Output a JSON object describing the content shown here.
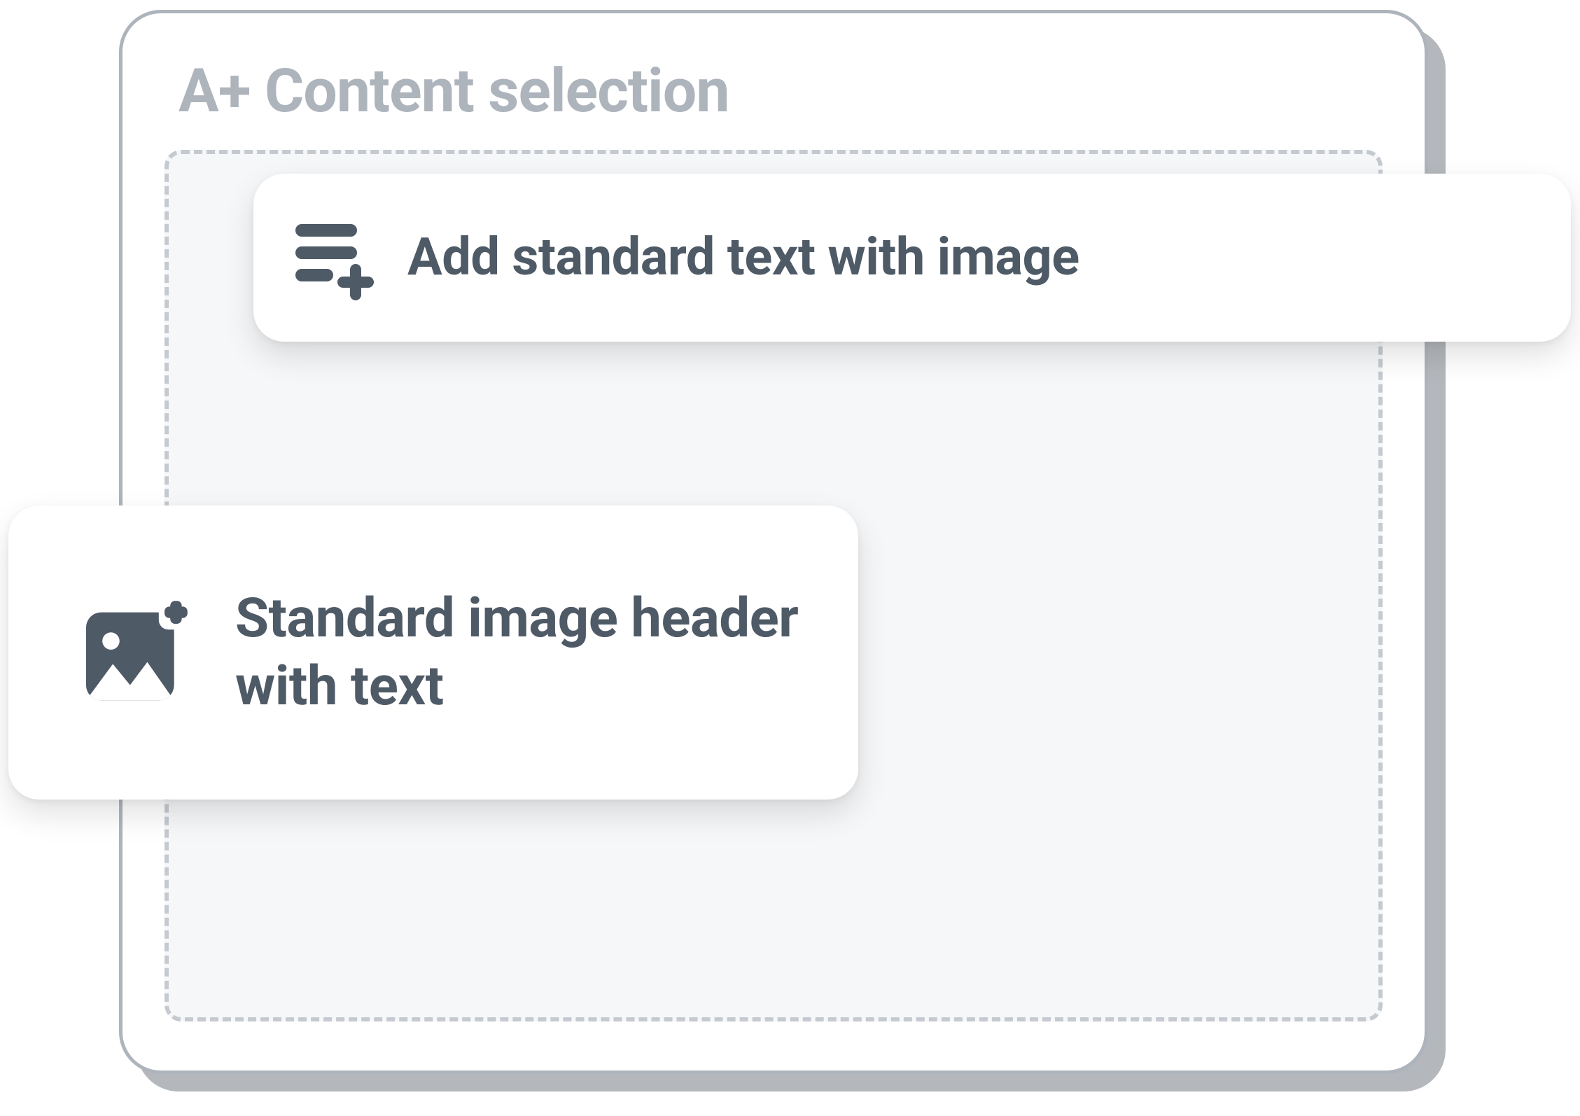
{
  "panel": {
    "title": "A+ Content selection"
  },
  "cards": [
    {
      "label": "Add standard text with image"
    },
    {
      "label": "Standard image header with text"
    }
  ]
}
